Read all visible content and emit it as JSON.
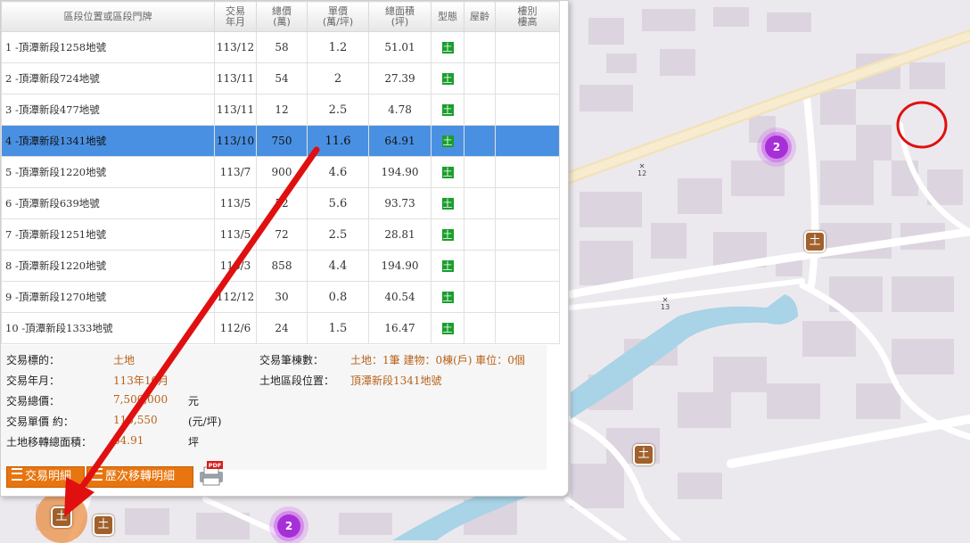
{
  "table": {
    "headers": [
      {
        "l1": "區段位置或區段門牌",
        "l2": ""
      },
      {
        "l1": "交易",
        "l2": "年月"
      },
      {
        "l1": "總價",
        "l2": "(萬)"
      },
      {
        "l1": "單價",
        "l2": "(萬/坪)"
      },
      {
        "l1": "總面積",
        "l2": "(坪)"
      },
      {
        "l1": "型態",
        "l2": ""
      },
      {
        "l1": "屋齡",
        "l2": ""
      },
      {
        "l1": "樓別",
        "l2": "樓高"
      }
    ],
    "rows": [
      {
        "addr": "1 -頂潭新段1258地號",
        "ym": "113/12",
        "total": "58",
        "unit": "1.2",
        "area": "51.01",
        "type": "土"
      },
      {
        "addr": "2 -頂潭新段724地號",
        "ym": "113/11",
        "total": "54",
        "unit": "2",
        "area": "27.39",
        "type": "土"
      },
      {
        "addr": "3 -頂潭新段477地號",
        "ym": "113/11",
        "total": "12",
        "unit": "2.5",
        "area": "4.78",
        "type": "土"
      },
      {
        "addr": "4 -頂潭新段1341地號",
        "ym": "113/10",
        "total": "750",
        "unit": "11.6",
        "area": "64.91",
        "type": "土"
      },
      {
        "addr": "5 -頂潭新段1220地號",
        "ym": "113/7",
        "total": "900",
        "unit": "4.6",
        "area": "194.90",
        "type": "土"
      },
      {
        "addr": "6 -頂潭新段639地號",
        "ym": "113/5",
        "total": "52",
        "unit": "5.6",
        "area": "93.73",
        "type": "土"
      },
      {
        "addr": "7 -頂潭新段1251地號",
        "ym": "113/5",
        "total": "72",
        "unit": "2.5",
        "area": "28.81",
        "type": "土"
      },
      {
        "addr": "8 -頂潭新段1220地號",
        "ym": "113/3",
        "total": "858",
        "unit": "4.4",
        "area": "194.90",
        "type": "土"
      },
      {
        "addr": "9 -頂潭新段1270地號",
        "ym": "112/12",
        "total": "30",
        "unit": "0.8",
        "area": "40.54",
        "type": "土"
      },
      {
        "addr": "10 -頂潭新段1333地號",
        "ym": "112/6",
        "total": "24",
        "unit": "1.5",
        "area": "16.47",
        "type": "土"
      }
    ],
    "selected_row": 3
  },
  "detail": {
    "target_label": "交易標的：",
    "target_value": "土地",
    "ym_label": "交易年月：",
    "ym_value": "113年10月",
    "total_label": "交易總價：",
    "total_value": "7,500,000",
    "total_unit": "元",
    "unitprice_label": "交易單價 約：",
    "unitprice_value": "115,550",
    "unitprice_unit": "(元/坪)",
    "area_label": "土地移轉總面積：",
    "area_value": "64.91",
    "area_unit": "坪",
    "count_label": "交易筆棟數：",
    "count_value": "土地：1筆 建物：0棟(戶) 車位：0個",
    "loc_label": "土地區段位置：",
    "loc_value": "頂潭新段1341地號"
  },
  "buttons": {
    "detail_label": "交易明細",
    "history_label": "歷次移轉明細",
    "pdf_badge": "PDF"
  },
  "map": {
    "land_marker_text": "土",
    "cluster_count_1": "2",
    "cluster_count_2": "2",
    "road_label_1": "12",
    "road_label_2": "13"
  },
  "colors": {
    "selected_row": "#4a90e2",
    "value_text": "#b8621a",
    "button_orange": "#e8750f",
    "land_badge_green": "#1a9e2c",
    "land_marker_brown": "#a0612c",
    "cluster_purple": "#a72fd8",
    "annotation_red": "#e01010"
  }
}
